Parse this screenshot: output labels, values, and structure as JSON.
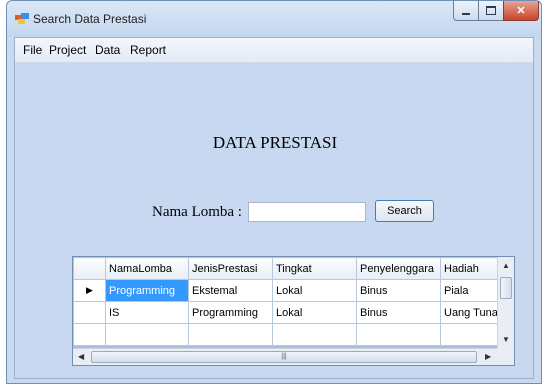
{
  "window": {
    "title": "Search Data Prestasi"
  },
  "menu": [
    "File",
    "Project",
    "Data",
    "Report"
  ],
  "heading": "DATA PRESTASI",
  "search": {
    "label": "Nama Lomba :",
    "value": "",
    "button": "Search"
  },
  "grid": {
    "columns": [
      "NamaLomba",
      "JenisPrestasi",
      "Tingkat",
      "Penyelenggara",
      "Hadiah"
    ],
    "rows": [
      [
        "Programming",
        "Ekstemal",
        "Lokal",
        "Binus",
        "Piala"
      ],
      [
        "IS",
        "Programming",
        "Lokal",
        "Binus",
        "Uang Tunai"
      ]
    ],
    "current_row_marker": "▶"
  },
  "colors": {
    "selection": "#3399ff",
    "client_bg": "#c7d8f0"
  }
}
